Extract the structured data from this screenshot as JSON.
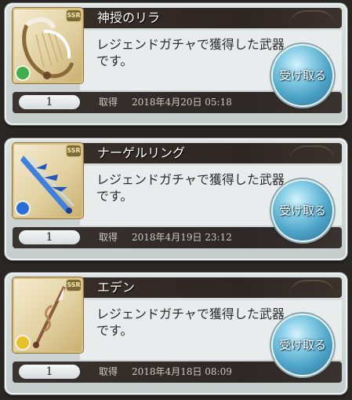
{
  "items": [
    {
      "name": "神授のリラ",
      "description": "レジェンドガチャで獲得した武器です。",
      "rarity": "SSR",
      "element": "wind",
      "element_color": "#3fae4a",
      "icon": "lyre-weapon-icon",
      "quantity": "1",
      "acquired_label": "取得",
      "acquired_date": "2018年4月20日 05:18",
      "button_label": "受け取る"
    },
    {
      "name": "ナーゲルリング",
      "description": "レジェンドガチャで獲得した武器です。",
      "rarity": "SSR",
      "element": "water",
      "element_color": "#2a6fd8",
      "icon": "blue-sword-icon",
      "quantity": "1",
      "acquired_label": "取得",
      "acquired_date": "2018年4月19日 23:12",
      "button_label": "受け取る"
    },
    {
      "name": "エデン",
      "description": "レジェンドガチャで獲得した武器です。",
      "rarity": "SSR",
      "element": "light",
      "element_color": "#e6c229",
      "icon": "spear-weapon-icon",
      "quantity": "1",
      "acquired_label": "取得",
      "acquired_date": "2018年4月18日 08:09",
      "button_label": "受け取る"
    }
  ]
}
